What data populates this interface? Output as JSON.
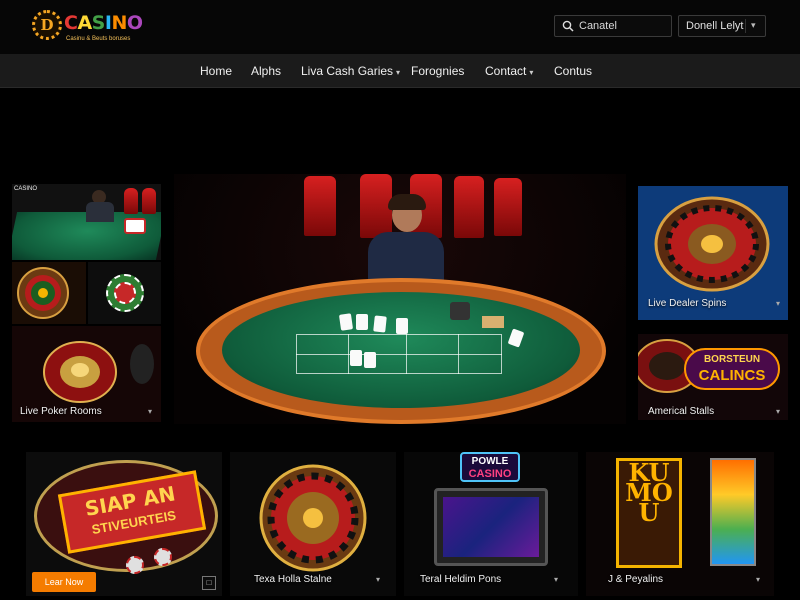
{
  "header": {
    "logo_badge": "D",
    "logo_letters": [
      "C",
      "A",
      "S",
      "I",
      "N",
      "O"
    ],
    "logo_tagline": "Casinu & Beuts boruses",
    "search_value": "Canatel",
    "language_value": "Donell Lelyt"
  },
  "nav": {
    "items": [
      {
        "label": "Home"
      },
      {
        "label": "Alphs"
      },
      {
        "label": "Liva Cash Garies",
        "has_dropdown": true
      },
      {
        "label": "Forognies"
      },
      {
        "label": "Contact",
        "has_dropdown": true
      },
      {
        "label": "Contus"
      }
    ]
  },
  "tiles": {
    "left_column": {
      "caption": "Live Poker Rooms",
      "mini_banner": "CASINO"
    },
    "right_top": {
      "caption": "Live Dealer Spins"
    },
    "right_bottom": {
      "caption": "Americal Stalls",
      "banner_line1": "BORSTEUN",
      "banner_line2": "CALINCS"
    },
    "bottom_1": {
      "sign_line1": "SIAP AN",
      "sign_line2": "STIVEURTEIS",
      "cta_label": "Lear Now"
    },
    "bottom_2": {
      "caption": "Texa Holla Stalne"
    },
    "bottom_3": {
      "logo_line1": "POWLE",
      "logo_line2": "CASINO",
      "caption": "Teral Heldim Pons"
    },
    "bottom_4": {
      "sign_text": "KUMOU",
      "caption": "J & Peyalins"
    }
  },
  "colors": {
    "accent_orange": "#f57c00",
    "felt_green": "#0f5b3a",
    "rail_orange": "#c8641e",
    "chair_red": "#d72020",
    "gold": "#f5b400"
  },
  "icons": [
    "search-icon",
    "chevron-down-icon",
    "roulette-wheel-icon",
    "slot-machine-icon"
  ]
}
